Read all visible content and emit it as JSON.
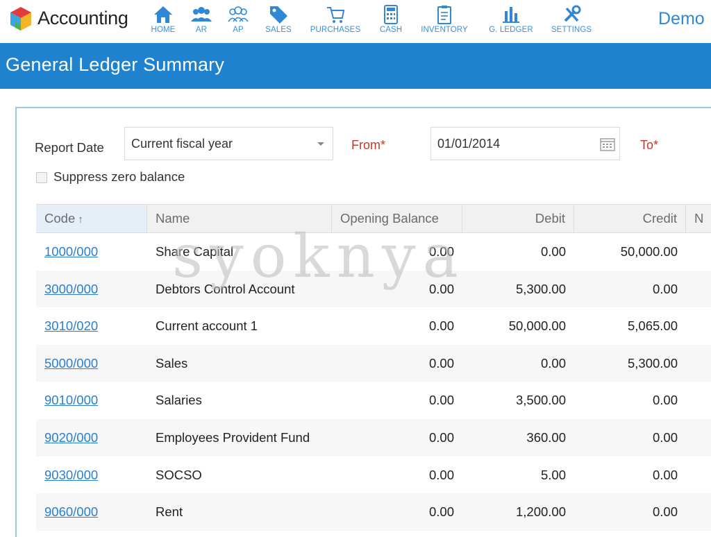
{
  "app": {
    "title": "Accounting",
    "user_label": "Demo"
  },
  "nav": [
    {
      "label": "HOME",
      "icon": "home-icon"
    },
    {
      "label": "AR",
      "icon": "users-icon"
    },
    {
      "label": "AP",
      "icon": "users-outline-icon"
    },
    {
      "label": "SALES",
      "icon": "tag-icon"
    },
    {
      "label": "PURCHASES",
      "icon": "cart-icon"
    },
    {
      "label": "CASH",
      "icon": "calculator-icon"
    },
    {
      "label": "INVENTORY",
      "icon": "clipboard-icon"
    },
    {
      "label": "G. LEDGER",
      "icon": "bar-chart-icon"
    },
    {
      "label": "SETTINGS",
      "icon": "tools-icon"
    }
  ],
  "page": {
    "title": "General Ledger Summary"
  },
  "filters": {
    "report_date_label": "Report Date",
    "report_date_value": "Current fiscal year",
    "from_label": "From*",
    "from_value": "01/01/2014",
    "to_label": "To*",
    "suppress_zero_label": "Suppress zero balance",
    "suppress_zero_checked": false
  },
  "table": {
    "columns": [
      {
        "key": "code",
        "label": "Code",
        "sort": "asc"
      },
      {
        "key": "name",
        "label": "Name"
      },
      {
        "key": "opening",
        "label": "Opening Balance"
      },
      {
        "key": "debit",
        "label": "Debit"
      },
      {
        "key": "credit",
        "label": "Credit"
      },
      {
        "key": "net",
        "label": "N"
      }
    ],
    "rows": [
      {
        "code": "1000/000",
        "name": "Share Capital",
        "opening": "0.00",
        "debit": "0.00",
        "credit": "50,000.00"
      },
      {
        "code": "3000/000",
        "name": "Debtors Control Account",
        "opening": "0.00",
        "debit": "5,300.00",
        "credit": "0.00"
      },
      {
        "code": "3010/020",
        "name": "Current account 1",
        "opening": "0.00",
        "debit": "50,000.00",
        "credit": "5,065.00"
      },
      {
        "code": "5000/000",
        "name": "Sales",
        "opening": "0.00",
        "debit": "0.00",
        "credit": "5,300.00"
      },
      {
        "code": "9010/000",
        "name": "Salaries",
        "opening": "0.00",
        "debit": "3,500.00",
        "credit": "0.00"
      },
      {
        "code": "9020/000",
        "name": "Employees Provident Fund",
        "opening": "0.00",
        "debit": "360.00",
        "credit": "0.00"
      },
      {
        "code": "9030/000",
        "name": "SOCSO",
        "opening": "0.00",
        "debit": "5.00",
        "credit": "0.00"
      },
      {
        "code": "9060/000",
        "name": "Rent",
        "opening": "0.00",
        "debit": "1,200.00",
        "credit": "0.00"
      }
    ]
  },
  "watermark": "syoknya",
  "colors": {
    "brand_blue": "#1f82cf",
    "nav_blue": "#3a8fd9",
    "link_blue": "#2a7fd0",
    "required_red": "#c0392b"
  }
}
